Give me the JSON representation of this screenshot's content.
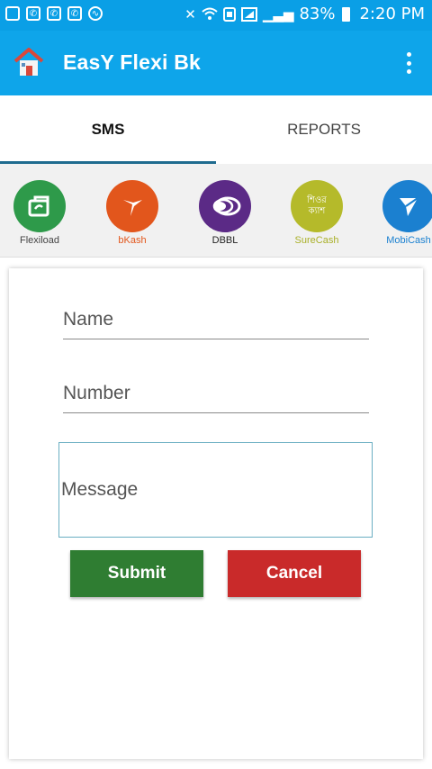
{
  "status_bar": {
    "battery": "83%",
    "time": "2:20 PM",
    "glyphs": {
      "mute": "✕",
      "signal": "▁▃▅"
    }
  },
  "app_bar": {
    "title": "EasY Flexi Bk",
    "accent": "#0ea5ea"
  },
  "tabs": [
    {
      "label": "SMS",
      "active": true
    },
    {
      "label": "REPORTS",
      "active": false
    }
  ],
  "services": [
    {
      "label": "Flexiload",
      "color": "#2e9a4a",
      "label_color": "#444444",
      "icon": "flexiload-icon"
    },
    {
      "label": "bKash",
      "color": "#e2561c",
      "label_color": "#e2561c",
      "icon": "bkash-bird-icon"
    },
    {
      "label": "DBBL",
      "color": "#5b2a86",
      "label_color": "#222222",
      "icon": "dbbl-logo-icon"
    },
    {
      "label": "SureCash",
      "color": "#b5ba2a",
      "label_color": "#a9b028",
      "icon": "surecash-logo-icon",
      "logo_text": "শিওর\nক্যাশ"
    },
    {
      "label": "MobiCash",
      "color": "#1b80d0",
      "label_color": "#1b80d0",
      "icon": "mobicash-logo-icon"
    }
  ],
  "form": {
    "name_placeholder": "Name",
    "number_placeholder": "Number",
    "message_placeholder": "Message",
    "submit_label": "Submit",
    "cancel_label": "Cancel"
  }
}
